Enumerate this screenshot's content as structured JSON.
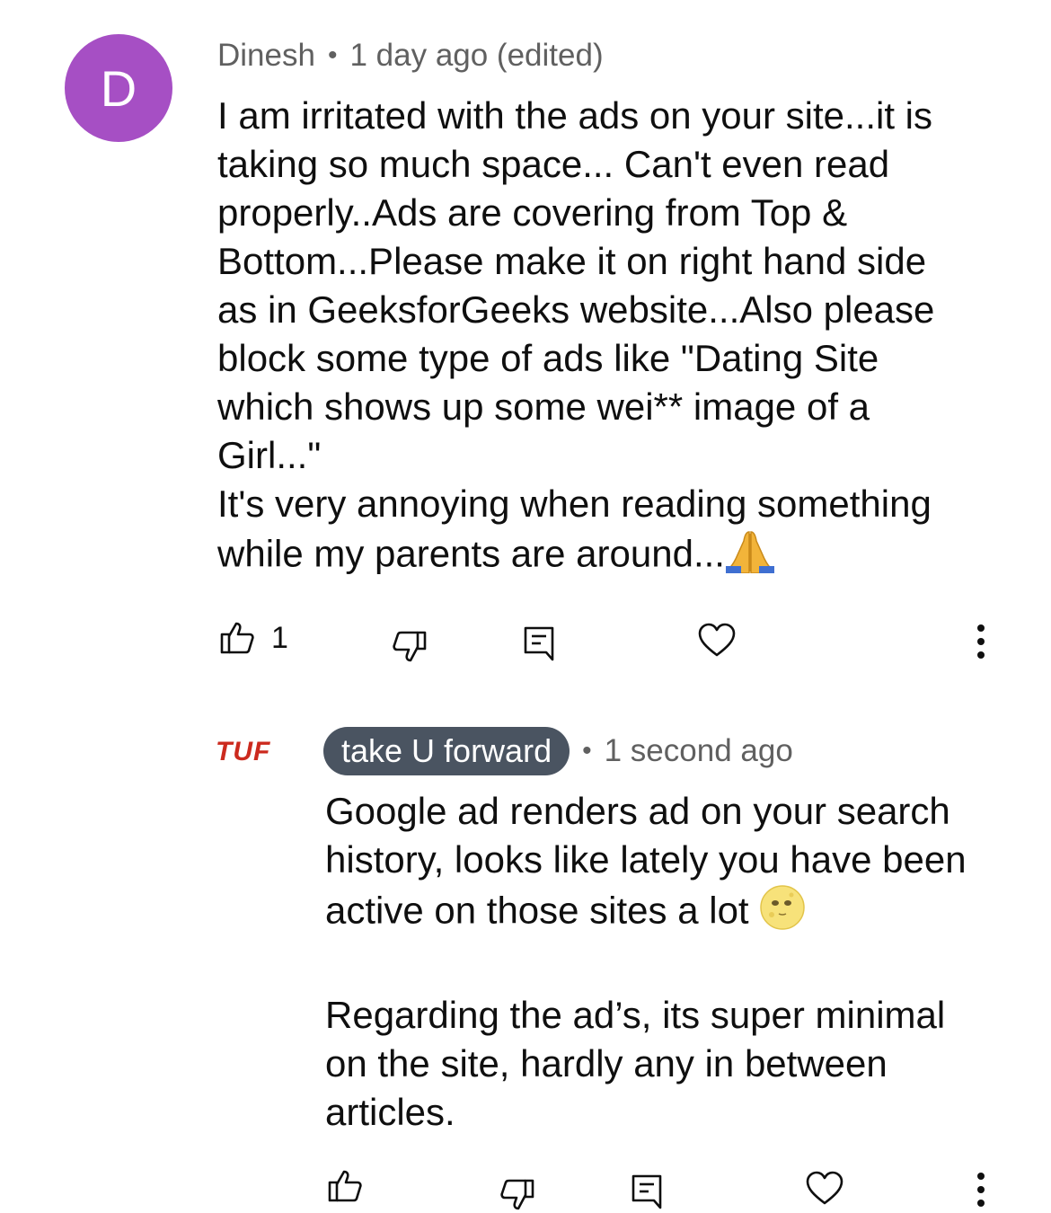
{
  "comment": {
    "avatar_letter": "D",
    "avatar_color": "#a64fc4",
    "author": "Dinesh",
    "separator": "•",
    "time": "1 day ago (edited)",
    "text": "I am irritated with the ads on your site...it is\ntaking so much space... Can't even read\nproperly..Ads are covering from Top &\nBottom...Please make it on right hand side\nas in GeeksforGeeks website...Also please\nblock some type of ads like \"Dating Site\nwhich shows up some wei** image of a\nGirl...\"\nIt's very annoying when reading something\nwhile my parents are around...",
    "emoji": "folded-hands",
    "like_count": "1"
  },
  "reply": {
    "logo_text": "TUF",
    "author": "take U forward",
    "author_chip_color": "#4a5461",
    "separator": "•",
    "time": "1 second ago",
    "text_line1": "Google ad renders ad on your search\nhistory, looks like lately you have been\nactive on those sites a lot ",
    "emoji": "moon-face",
    "text_line2": "\n\nRegarding the ad’s, its super minimal\non the site, hardly any in between\narticles."
  },
  "icons": {
    "like": "thumbs-up-icon",
    "dislike": "thumbs-down-icon",
    "reply": "reply-icon",
    "heart": "heart-icon",
    "more": "more-vertical-icon"
  }
}
